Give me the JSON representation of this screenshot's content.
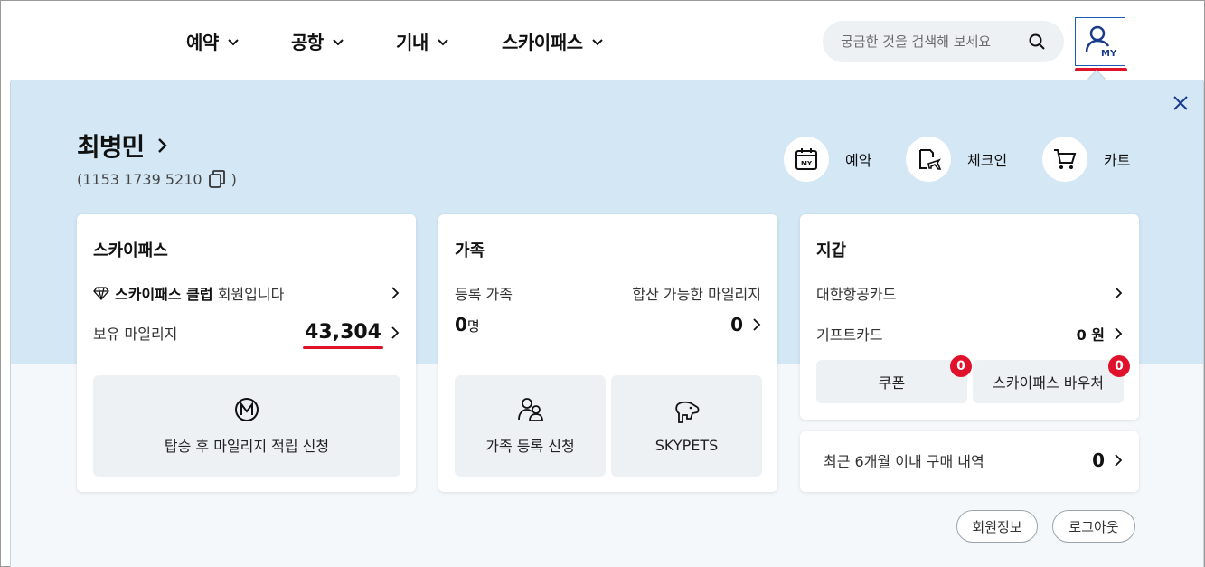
{
  "nav": {
    "items": [
      {
        "label": "예약"
      },
      {
        "label": "공항"
      },
      {
        "label": "기내"
      },
      {
        "label": "스카이패스"
      }
    ],
    "search_placeholder": "궁금한 것을 검색해 보세요",
    "my_label": "MY"
  },
  "profile": {
    "name": "최병민",
    "member_no": "(1153 1739 5210",
    "member_no_close": ")"
  },
  "quick_links": [
    {
      "label": "예약",
      "icon_text": "MY"
    },
    {
      "label": "체크인"
    },
    {
      "label": "카트"
    }
  ],
  "skypass": {
    "title": "스카이패스",
    "club_bold": "스카이패스 클럽",
    "club_rest": " 회원입니다",
    "mileage_label": "보유 마일리지",
    "mileage_value": "43,304",
    "accrual_label": "탑승 후 마일리지 적립 신청",
    "accent": "#e0112b"
  },
  "family": {
    "title": "가족",
    "registered_label": "등록 가족",
    "combined_label": "합산 가능한 마일리지",
    "registered_count": "0",
    "registered_unit": "명",
    "combined_value": "0",
    "register_btn": "가족 등록 신청",
    "skypets_btn": "SKYPETS"
  },
  "wallet": {
    "title": "지갑",
    "kal_card": "대한항공카드",
    "gift_card": "기프트카드",
    "gift_value": "0 원",
    "coupon_label": "쿠폰",
    "coupon_count": "0",
    "voucher_label": "스카이패스 바우처",
    "voucher_count": "0"
  },
  "purchases": {
    "label": "최근 6개월 이내 구매 내역",
    "value": "0"
  },
  "footer": {
    "member_info": "회원정보",
    "logout": "로그아웃"
  },
  "colors": {
    "panel_bg": "#d3e7f5",
    "accent_red": "#e0112b",
    "brand_blue": "#1a3a8c"
  }
}
